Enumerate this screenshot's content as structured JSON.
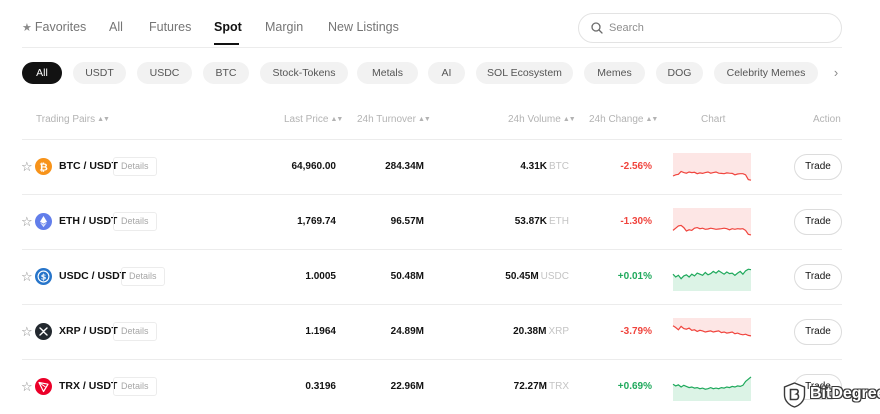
{
  "nav": {
    "favorites": "Favorites",
    "tabs": [
      "All",
      "Futures",
      "Spot",
      "Margin",
      "New Listings"
    ],
    "active_tab": "Spot"
  },
  "search": {
    "placeholder": "Search"
  },
  "filters": {
    "chips": [
      "All",
      "USDT",
      "USDC",
      "BTC",
      "Stock-Tokens",
      "Metals",
      "AI",
      "SOL Ecosystem",
      "Memes",
      "DOG",
      "Celebrity Memes"
    ],
    "active": "All"
  },
  "table": {
    "headers": {
      "pair": "Trading Pairs",
      "last_price": "Last Price",
      "turnover": "24h Turnover",
      "volume": "24h Volume",
      "change": "24h Change",
      "chart": "Chart",
      "action": "Action"
    },
    "details_label": "Details",
    "trade_label": "Trade",
    "rows": [
      {
        "pair": "BTC / USDT",
        "icon": "bitcoin-icon",
        "icon_color": "#f7931a",
        "last_price": "64,960.00",
        "turnover": "284.34M",
        "volume": "4.31K",
        "volume_unit": "BTC",
        "change": "-2.56%",
        "direction": "down",
        "spark": [
          0.82,
          0.78,
          0.76,
          0.66,
          0.7,
          0.72,
          0.68,
          0.7,
          0.69,
          0.74,
          0.71,
          0.73,
          0.7,
          0.68,
          0.72,
          0.7,
          0.68,
          0.72,
          0.73,
          0.74,
          0.71,
          0.72,
          0.73,
          0.78,
          0.75,
          0.74,
          0.74,
          0.78,
          0.95,
          0.97
        ]
      },
      {
        "pair": "ETH / USDT",
        "icon": "ethereum-icon",
        "icon_color": "#627eea",
        "last_price": "1,769.74",
        "turnover": "96.57M",
        "volume": "53.87K",
        "volume_unit": "ETH",
        "change": "-1.30%",
        "direction": "down",
        "spark": [
          0.8,
          0.72,
          0.64,
          0.62,
          0.7,
          0.82,
          0.78,
          0.8,
          0.72,
          0.7,
          0.74,
          0.72,
          0.76,
          0.75,
          0.72,
          0.74,
          0.76,
          0.75,
          0.74,
          0.72,
          0.74,
          0.78,
          0.74,
          0.76,
          0.74,
          0.75,
          0.74,
          0.8,
          0.94,
          0.96
        ]
      },
      {
        "pair": "USDC / USDT",
        "icon": "usdc-icon",
        "icon_color": "#2775ca",
        "last_price": "1.0005",
        "turnover": "50.48M",
        "volume": "50.45M",
        "volume_unit": "USDC",
        "change": "+0.01%",
        "direction": "up",
        "spark": [
          0.4,
          0.5,
          0.44,
          0.56,
          0.46,
          0.42,
          0.5,
          0.4,
          0.46,
          0.36,
          0.4,
          0.44,
          0.34,
          0.42,
          0.38,
          0.3,
          0.36,
          0.28,
          0.34,
          0.4,
          0.32,
          0.38,
          0.36,
          0.44,
          0.36,
          0.3,
          0.4,
          0.28,
          0.22,
          0.24
        ]
      },
      {
        "pair": "XRP / USDT",
        "icon": "xrp-icon",
        "icon_color": "#23292f",
        "last_price": "1.1964",
        "turnover": "24.89M",
        "volume": "20.38M",
        "volume_unit": "XRP",
        "change": "-3.79%",
        "direction": "down",
        "spark": [
          0.28,
          0.34,
          0.42,
          0.3,
          0.38,
          0.4,
          0.36,
          0.44,
          0.42,
          0.48,
          0.44,
          0.46,
          0.5,
          0.48,
          0.46,
          0.5,
          0.48,
          0.46,
          0.52,
          0.5,
          0.54,
          0.52,
          0.5,
          0.56,
          0.54,
          0.58,
          0.6,
          0.58,
          0.62,
          0.64
        ]
      },
      {
        "pair": "TRX / USDT",
        "icon": "tron-icon",
        "icon_color": "#eb0029",
        "last_price": "0.3196",
        "turnover": "22.96M",
        "volume": "72.27M",
        "volume_unit": "TRX",
        "change": "+0.69%",
        "direction": "up",
        "spark": [
          0.4,
          0.46,
          0.42,
          0.5,
          0.44,
          0.48,
          0.52,
          0.5,
          0.54,
          0.52,
          0.56,
          0.54,
          0.58,
          0.56,
          0.52,
          0.56,
          0.54,
          0.56,
          0.52,
          0.54,
          0.5,
          0.52,
          0.48,
          0.5,
          0.46,
          0.48,
          0.44,
          0.3,
          0.22,
          0.14
        ]
      }
    ]
  },
  "colors": {
    "down": "#f0443d",
    "up": "#1fa95c",
    "down_fill": "#fde6e5",
    "up_fill": "#dcf3e6"
  },
  "watermark": {
    "text": "BitDegree",
    "icon": "bitdegree-shield-icon"
  }
}
